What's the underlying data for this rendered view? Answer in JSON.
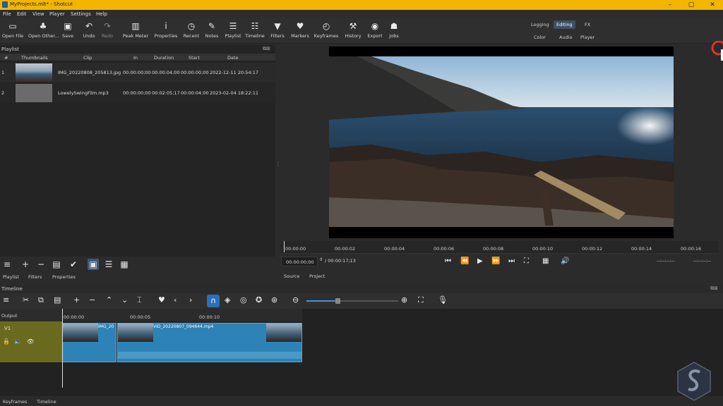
{
  "window": {
    "title": "MyProjects.mlt* - Shotcut"
  },
  "menu": [
    "File",
    "Edit",
    "View",
    "Player",
    "Settings",
    "Help"
  ],
  "toolbar": [
    "Open File",
    "Open Other...",
    "Save",
    "Undo",
    "Redo",
    "Peak Meter",
    "Properties",
    "Recent",
    "Notes",
    "Playlist",
    "Timeline",
    "Filters",
    "Markers",
    "Keyframes",
    "History",
    "Export",
    "Jobs"
  ],
  "layouts": {
    "row1": [
      "Logging",
      "Editing",
      "FX"
    ],
    "row2": [
      "Color",
      "Audio",
      "Player"
    ],
    "active": "Editing"
  },
  "playlist": {
    "title": "Playlist",
    "columns": [
      "#",
      "Thumbnails",
      "Clip",
      "In",
      "Duration",
      "Start",
      "Date"
    ],
    "rows": [
      {
        "num": "1",
        "clip": "IMG_20220808_205813.jpg",
        "in": "00:00:00;00",
        "duration": "00:00:04;00",
        "start": "00:00:00;00",
        "date": "2022-12-11 20:54:17"
      },
      {
        "num": "2",
        "clip": "LowelySwingFilm.mp3",
        "in": "00:00:00;00",
        "duration": "00:02:05;17",
        "start": "00:00:04;00",
        "date": "2023-02-04 18:22:11"
      }
    ],
    "tabs": [
      "Playlist",
      "Filters",
      "Properties"
    ]
  },
  "player": {
    "ruler": [
      "00:00:00",
      "00:00:02",
      "00:00:04",
      "00:00:06",
      "00:00:08",
      "00:00:10",
      "00:00:12",
      "00:00:14",
      "00:00:16"
    ],
    "position": "00:00:00;00",
    "duration": "/ 00:00:17;13",
    "in_point": "--:--:--:--",
    "out_point": "--:--:--:--",
    "tabs": [
      "Source",
      "Project"
    ]
  },
  "timeline": {
    "title": "Timeline",
    "output_label": "Output",
    "track": "V1",
    "ruler": [
      "00:00:00",
      "00:00:05",
      "00:00:10"
    ],
    "clips": [
      {
        "label": "IMG_20"
      },
      {
        "label": "VID_20220807_094644.mp4"
      }
    ]
  },
  "bottom_tabs": [
    "Keyframes",
    "Timeline"
  ]
}
